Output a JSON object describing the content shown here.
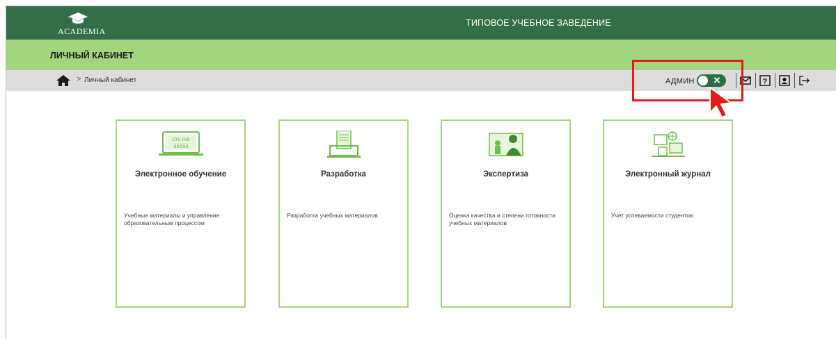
{
  "header": {
    "logo_text": "ACADEMIA",
    "institution_title": "ТИПОВОЕ УЧЕБНОЕ ЗАВЕДЕНИЕ"
  },
  "subheader": {
    "page_title": "ЛИЧНЫЙ КАБИНЕТ"
  },
  "breadcrumb": {
    "separator": ">",
    "current": "Личный кабинет"
  },
  "toolbar": {
    "admin_label": "АДМИН",
    "toggle_symbol": "✕",
    "icons": [
      "envelope-icon",
      "help-icon",
      "profile-icon",
      "logout-icon"
    ]
  },
  "colors": {
    "header_bg": "#336e49",
    "subheader_bg": "#a2d57e",
    "breadcrumb_bg": "#dcdcdc",
    "card_border": "#a2d57e",
    "highlight": "#e31b1b"
  },
  "cards": [
    {
      "title": "Электронное обучение",
      "description": "Учебные материалы и управление образовательным процессом",
      "icon": "online-learning-icon"
    },
    {
      "title": "Разработка",
      "description": "Разработка учебных материалов",
      "icon": "development-icon"
    },
    {
      "title": "Экспертиза",
      "description": "Оценка качества и степени готовности учебных материалов",
      "icon": "expertise-icon"
    },
    {
      "title": "Электронный журнал",
      "description": "Учет успеваемости студентов",
      "icon": "journal-icon"
    }
  ]
}
